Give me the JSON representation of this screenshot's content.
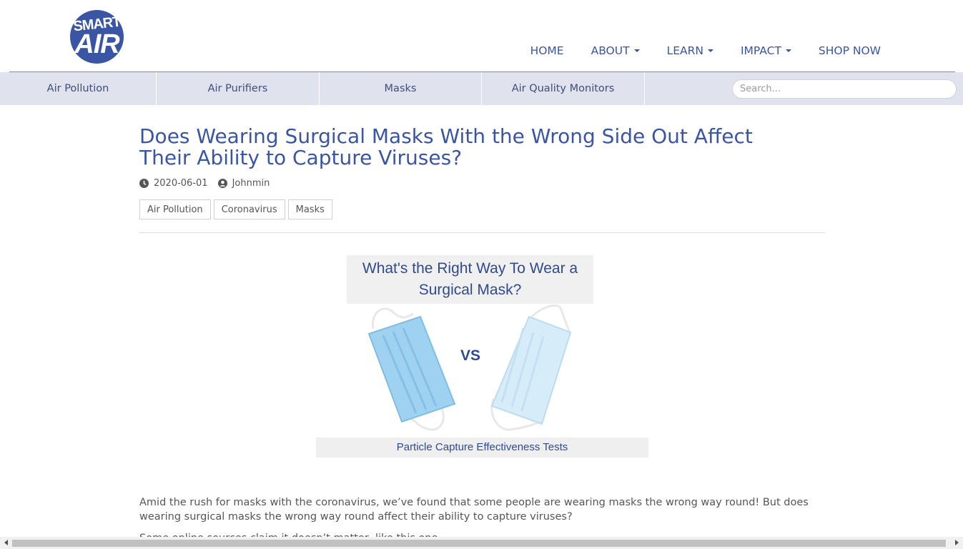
{
  "brand": {
    "line1": "SMART",
    "line2": "AIR"
  },
  "nav": [
    {
      "label": "HOME",
      "dropdown": false
    },
    {
      "label": "ABOUT",
      "dropdown": true
    },
    {
      "label": "LEARN",
      "dropdown": true
    },
    {
      "label": "IMPACT",
      "dropdown": true
    },
    {
      "label": "SHOP NOW",
      "dropdown": false
    }
  ],
  "categories": [
    "Air Pollution",
    "Air Purifiers",
    "Masks",
    "Air Quality Monitors"
  ],
  "search": {
    "placeholder": "Search..."
  },
  "article": {
    "title": "Does Wearing Surgical Masks With the Wrong Side Out Affect Their Ability to Capture Viruses?",
    "date": "2020-06-01",
    "author": "Johnmin",
    "tags": [
      "Air Pollution",
      "Coronavirus",
      "Masks"
    ],
    "figure": {
      "heading": "What's the Right Way To Wear a Surgical Mask?",
      "vs": "VS",
      "caption": "Particle Capture Effectiveness Tests"
    },
    "paragraph1": "Amid the rush for masks with the coronavirus, we’ve found that some people are wearing masks the wrong way round! But does wearing surgical masks the wrong way round affect their ability to capture viruses?",
    "paragraph2": "Some online sources claim it doesn’t matter, like this one."
  },
  "colors": {
    "brand": "#3a55a4",
    "catbar": "#e0e3ee"
  }
}
